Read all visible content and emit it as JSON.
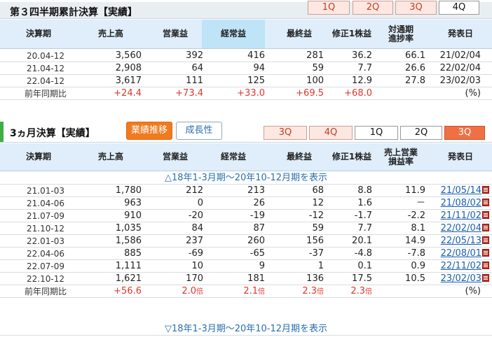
{
  "sec1": {
    "title": "第３四半期累計決算【実績】",
    "quarter_tabs": [
      "1Q",
      "2Q",
      "3Q",
      "4Q"
    ],
    "headers": [
      "決算期",
      "売上高",
      "営業益",
      "経常益",
      "最終益",
      "修正1株益",
      "対通期\n進捗率",
      "発表日"
    ],
    "rows": [
      {
        "period": "20.04-12",
        "sales": "3,560",
        "op": "392",
        "ord": "416",
        "net": "281",
        "eps": "36.2",
        "prog": "66.1",
        "date": "21/02/04"
      },
      {
        "period": "21.04-12",
        "sales": "2,908",
        "op": "64",
        "ord": "94",
        "net": "59",
        "eps": "7.7",
        "prog": "26.6",
        "date": "22/02/04"
      },
      {
        "period": "22.04-12",
        "sales": "3,617",
        "op": "111",
        "ord": "125",
        "net": "100",
        "eps": "12.9",
        "prog": "27.8",
        "date": "23/02/03"
      }
    ],
    "yoy": {
      "label": "前年同期比",
      "sales": "+24.4",
      "op": "+73.4",
      "ord": "+33.0",
      "net": "+69.5",
      "eps": "+68.0",
      "unit": "(%)"
    }
  },
  "sec2": {
    "title": "3ヵ月決算【実績】",
    "btn_trend": "業績推移",
    "btn_growth": "成長性",
    "quarter_tabs": [
      "3Q",
      "4Q",
      "1Q",
      "2Q",
      "3Q"
    ],
    "headers": [
      "決算期",
      "売上高",
      "営業益",
      "経常益",
      "最終益",
      "修正1株益",
      "売上営業\n損益率",
      "発表日"
    ],
    "show_top": "△18年1-3月期～20年10-12月期を表示",
    "show_bottom": "▽18年1-3月期～20年10-12月期を表示",
    "rows": [
      {
        "period": "21.01-03",
        "sales": "1,780",
        "op": "212",
        "ord": "213",
        "net": "68",
        "eps": "8.8",
        "margin": "11.9",
        "date": "21/05/14"
      },
      {
        "period": "21.04-06",
        "sales": "963",
        "op": "0",
        "ord": "26",
        "net": "12",
        "eps": "1.6",
        "margin": "－",
        "date": "21/08/02"
      },
      {
        "period": "21.07-09",
        "sales": "910",
        "op": "-20",
        "ord": "-19",
        "net": "-12",
        "eps": "-1.7",
        "margin": "-2.2",
        "date": "21/11/02"
      },
      {
        "period": "21.10-12",
        "sales": "1,035",
        "op": "84",
        "ord": "87",
        "net": "59",
        "eps": "7.7",
        "margin": "8.1",
        "date": "22/02/04"
      },
      {
        "period": "22.01-03",
        "sales": "1,586",
        "op": "237",
        "ord": "260",
        "net": "156",
        "eps": "20.1",
        "margin": "14.9",
        "date": "22/05/13"
      },
      {
        "period": "22.04-06",
        "sales": "885",
        "op": "-69",
        "ord": "-65",
        "net": "-37",
        "eps": "-4.8",
        "margin": "-7.8",
        "date": "22/08/01"
      },
      {
        "period": "22.07-09",
        "sales": "1,111",
        "op": "10",
        "ord": "9",
        "net": "1",
        "eps": "0.1",
        "margin": "0.9",
        "date": "22/11/02"
      },
      {
        "period": "22.10-12",
        "sales": "1,621",
        "op": "170",
        "ord": "181",
        "net": "136",
        "eps": "17.5",
        "margin": "10.5",
        "date": "23/02/03"
      }
    ],
    "yoy": {
      "label": "前年同期比",
      "sales": "+56.6",
      "op": "2.0",
      "ord": "2.1",
      "net": "2.3",
      "eps": "2.3",
      "times": "倍",
      "unit": "(%)"
    }
  },
  "colors": {
    "accent_red": "#e0362c",
    "link": "#1a5fb4",
    "header_bg": "#dfeefa",
    "section_bar": "#3cb043",
    "orange": "#f07a1e"
  }
}
